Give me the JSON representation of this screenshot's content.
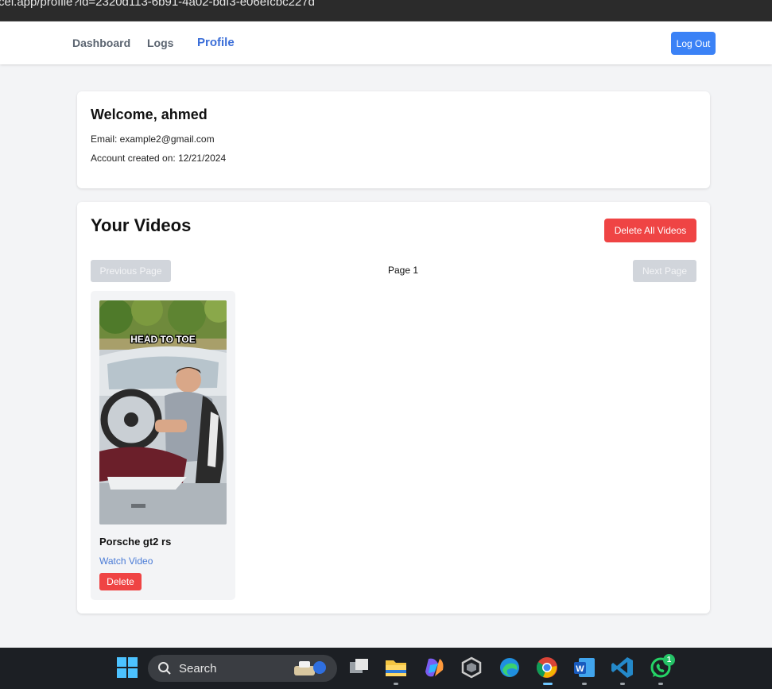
{
  "browser": {
    "url": "cel.app/profile?id=2320d113-6b91-4a02-bdf3-e06efcbc227d"
  },
  "nav": {
    "dashboard": "Dashboard",
    "logs": "Logs",
    "profile": "Profile",
    "logout": "Log Out"
  },
  "welcome": {
    "title": "Welcome, ahmed",
    "email": "Email: example2@gmail.com",
    "created": "Account created on: 12/21/2024"
  },
  "videos": {
    "title": "Your Videos",
    "delete_all": "Delete All Videos",
    "prev_page": "Previous Page",
    "next_page": "Next Page",
    "page_label": "Page 1",
    "items": [
      {
        "thumbnail_caption": "HEAD TO TOE",
        "title": "Porsche gt2 rs",
        "watch_label": "Watch Video",
        "delete_label": "Delete"
      }
    ]
  },
  "taskbar": {
    "search_label": "Search",
    "whatsapp_badge": "1",
    "icons": [
      "windows-icon",
      "search-icon",
      "task-view-icon",
      "file-explorer-icon",
      "copilot-icon",
      "app-icon",
      "edge-icon",
      "chrome-icon",
      "word-icon",
      "vscode-icon",
      "whatsapp-icon"
    ]
  },
  "colors": {
    "accent": "#3b82f6",
    "danger": "#ef4444",
    "disabled": "#d1d5db",
    "page_bg": "#f3f4f6"
  }
}
